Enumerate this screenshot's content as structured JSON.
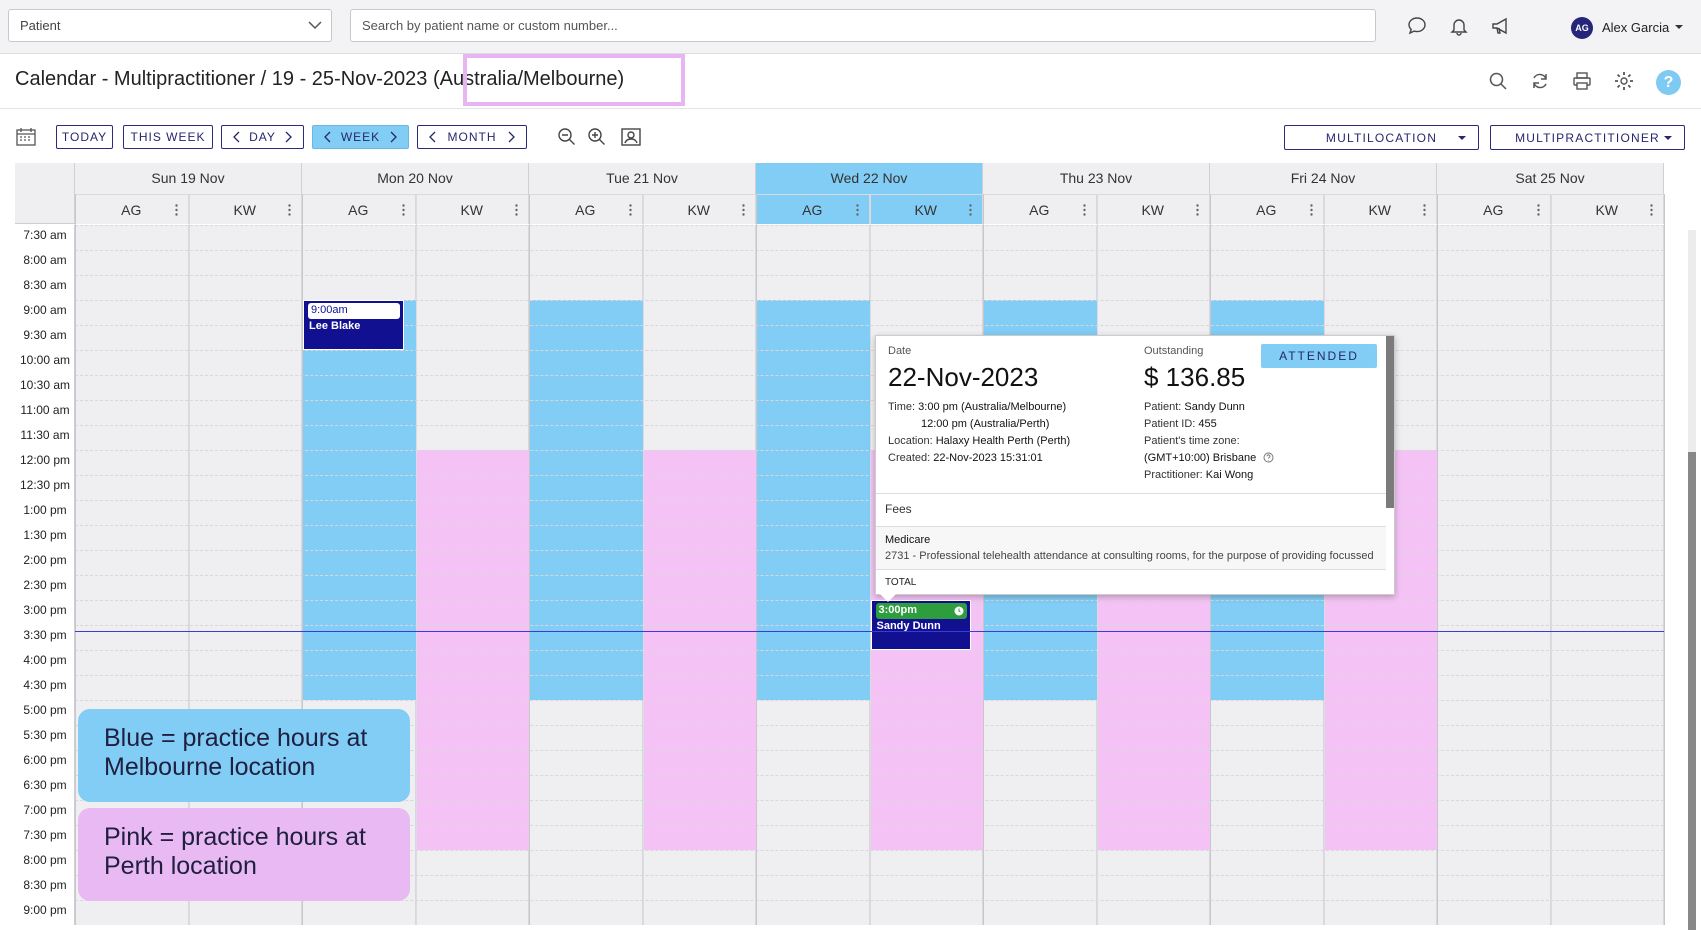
{
  "topbar": {
    "patient_select": "Patient",
    "search_placeholder": "Search by patient name or custom number...",
    "user_initials": "AG",
    "user_name": "Alex Garcia"
  },
  "title": {
    "main": "Calendar - Multipractitioner / 19 - 25-Nov-2023",
    "timezone": "(Australia/Melbourne)"
  },
  "toolbar": {
    "today": "TODAY",
    "this_week": "THIS WEEK",
    "day": "DAY",
    "week": "WEEK",
    "month": "MONTH",
    "multilocation": "MULTILOCATION",
    "multipractitioner": "MULTIPRACTITIONER",
    "help": "?"
  },
  "days": [
    {
      "label": "Sun 19 Nov",
      "highlight": false
    },
    {
      "label": "Mon 20 Nov",
      "highlight": false
    },
    {
      "label": "Tue 21 Nov",
      "highlight": false
    },
    {
      "label": "Wed 22 Nov",
      "highlight": true
    },
    {
      "label": "Thu 23 Nov",
      "highlight": false
    },
    {
      "label": "Fri 24 Nov",
      "highlight": false
    },
    {
      "label": "Sat 25 Nov",
      "highlight": false
    }
  ],
  "practitioners": [
    "AG",
    "KW"
  ],
  "times": [
    "7:30 am",
    "8:00 am",
    "8:30 am",
    "9:00 am",
    "9:30 am",
    "10:00 am",
    "10:30 am",
    "11:00 am",
    "11:30 am",
    "12:00 pm",
    "12:30 pm",
    "1:00 pm",
    "1:30 pm",
    "2:00 pm",
    "2:30 pm",
    "3:00 pm",
    "3:30 pm",
    "4:00 pm",
    "4:30 pm",
    "5:00 pm",
    "5:30 pm",
    "6:00 pm",
    "6:30 pm",
    "7:00 pm",
    "7:30 pm",
    "8:00 pm",
    "8:30 pm",
    "9:00 pm"
  ],
  "colors": {
    "melbourne": "#82cdf5",
    "perth": "#f4c2f4",
    "unavailable": "#efeff1",
    "event": "#101090",
    "attended_time": "#2e9d3e",
    "accent": "#26266e"
  },
  "availability": [
    {
      "day": 1,
      "prac": 0,
      "from": "9:00 am",
      "to": "5:00 pm",
      "loc": "melbourne"
    },
    {
      "day": 1,
      "prac": 1,
      "from": "12:00 pm",
      "to": "8:00 pm",
      "loc": "perth"
    },
    {
      "day": 2,
      "prac": 0,
      "from": "9:00 am",
      "to": "5:00 pm",
      "loc": "melbourne"
    },
    {
      "day": 2,
      "prac": 1,
      "from": "12:00 pm",
      "to": "8:00 pm",
      "loc": "perth"
    },
    {
      "day": 3,
      "prac": 0,
      "from": "9:00 am",
      "to": "5:00 pm",
      "loc": "melbourne"
    },
    {
      "day": 3,
      "prac": 1,
      "from": "12:00 pm",
      "to": "8:00 pm",
      "loc": "perth"
    },
    {
      "day": 4,
      "prac": 0,
      "from": "9:00 am",
      "to": "5:00 pm",
      "loc": "melbourne"
    },
    {
      "day": 4,
      "prac": 1,
      "from": "12:00 pm",
      "to": "8:00 pm",
      "loc": "perth"
    },
    {
      "day": 5,
      "prac": 0,
      "from": "9:00 am",
      "to": "5:00 pm",
      "loc": "melbourne"
    },
    {
      "day": 5,
      "prac": 1,
      "from": "12:00 pm",
      "to": "8:00 pm",
      "loc": "perth"
    }
  ],
  "appointments": [
    {
      "day": 1,
      "prac": 0,
      "start": "9:00 am",
      "time": "9:00am",
      "patient": "Lee Blake",
      "status": "booked"
    },
    {
      "day": 3,
      "prac": 1,
      "start": "3:00 pm",
      "time": "3:00pm",
      "patient": "Sandy Dunn",
      "status": "attended"
    }
  ],
  "current_time": "3:30 pm",
  "legend": {
    "blue": "Blue = practice hours at Melbourne location",
    "pink": "Pink = practice hours at Perth location"
  },
  "popup": {
    "date_label": "Date",
    "date": "22-Nov-2023",
    "outstanding_label": "Outstanding",
    "outstanding": "$ 136.85",
    "status": "ATTENDED",
    "time_label": "Time:",
    "time_melb": "3:00 pm (Australia/Melbourne)",
    "time_perth": "12:00 pm (Australia/Perth)",
    "location_label": "Location:",
    "location": "Halaxy Health Perth (Perth)",
    "created_label": "Created:",
    "created": "22-Nov-2023 15:31:01",
    "patient_label": "Patient:",
    "patient": "Sandy Dunn",
    "patient_id_label": "Patient ID:",
    "patient_id": "455",
    "tz_label": "Patient's time zone:",
    "tz": "(GMT+10:00) Brisbane",
    "practitioner_label": "Practitioner:",
    "practitioner": "Kai Wong",
    "fees_label": "Fees",
    "fee_name": "Medicare",
    "fee_desc": "2731 - Professional telehealth attendance at consulting rooms, for the purpose of providing focussed",
    "total_label": "TOTAL"
  }
}
